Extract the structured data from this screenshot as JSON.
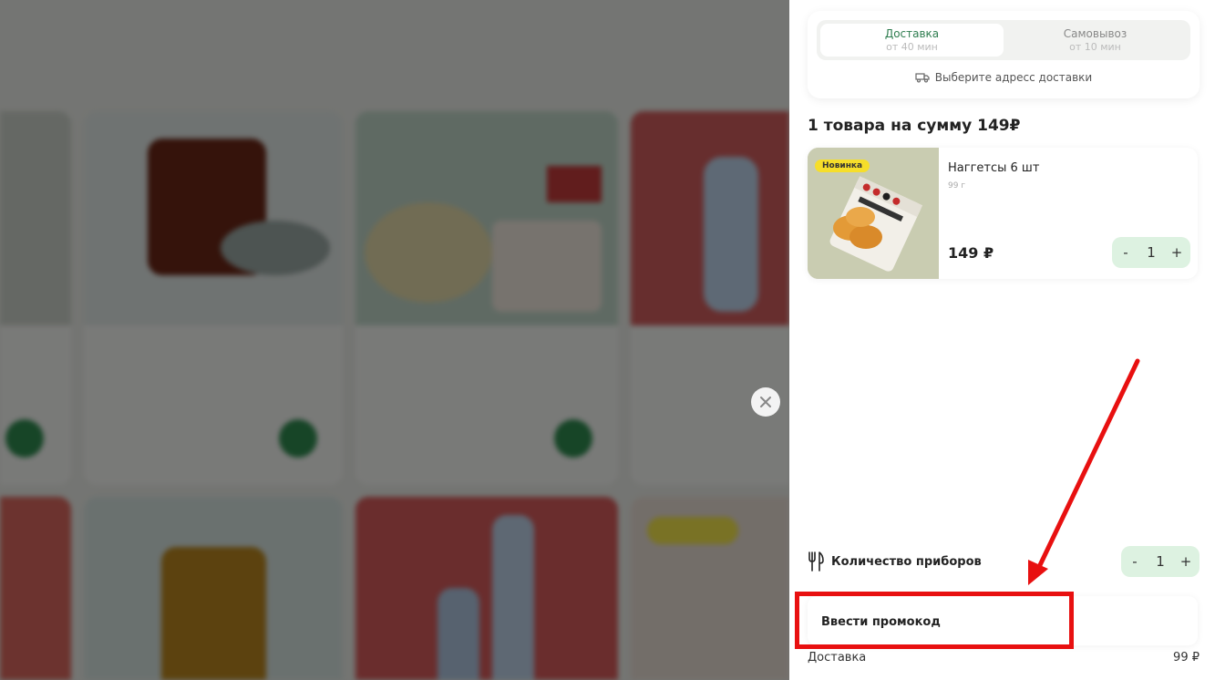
{
  "modal": {
    "delivery_tabs": [
      {
        "label": "Доставка",
        "sub": "от 40 мин"
      },
      {
        "label": "Самовывоз",
        "sub": "от 10 мин"
      }
    ],
    "address_prompt": "Выберите адресс доставки",
    "summary": "1 товара на сумму 149₽",
    "item": {
      "badge": "Новинка",
      "name": "Наггетсы 6 шт",
      "weight": "99 г",
      "price": "149 ₽",
      "qty": "1",
      "minus": "-",
      "plus": "+"
    },
    "cutlery": {
      "label": "Количество приборов",
      "qty": "1",
      "minus": "-",
      "plus": "+"
    },
    "promo_label": "Ввести промокод",
    "delivery_row": {
      "label": "Доставка",
      "value": "99 ₽"
    }
  },
  "colors": {
    "accent_green": "#2e7d4f",
    "stepper_bg": "#ddf2e1",
    "badge_yellow": "#f6de2a",
    "annotation_red": "#e81010"
  }
}
